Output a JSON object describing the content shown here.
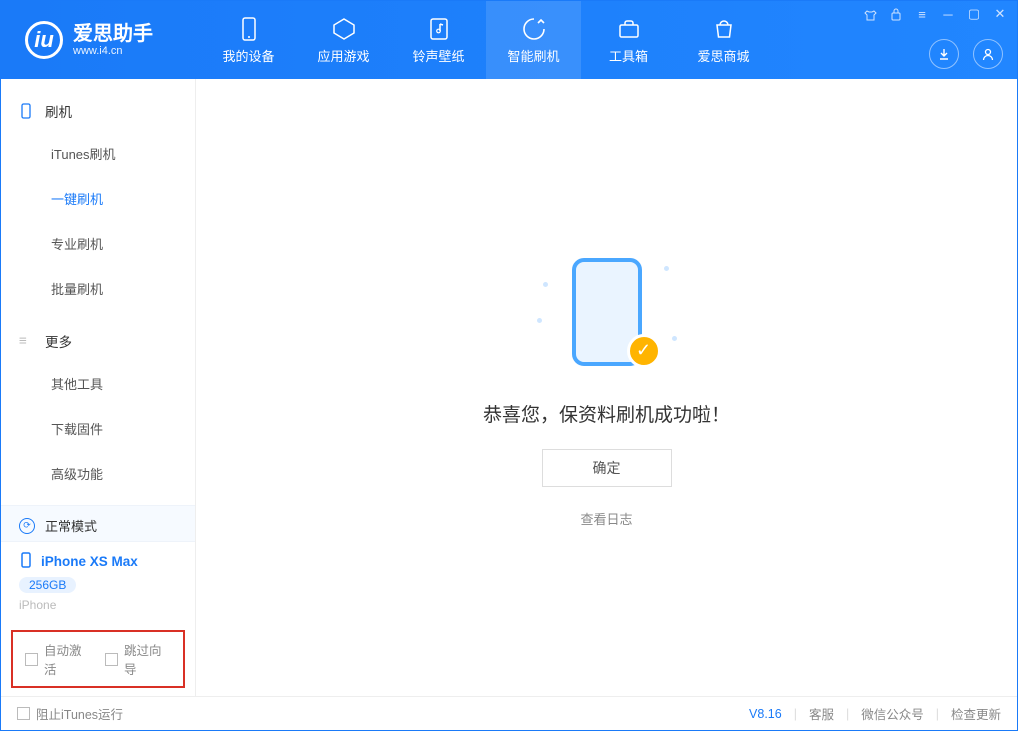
{
  "app": {
    "name": "爱思助手",
    "url": "www.i4.cn"
  },
  "tabs": [
    {
      "label": "我的设备",
      "icon": "device-icon"
    },
    {
      "label": "应用游戏",
      "icon": "apps-icon"
    },
    {
      "label": "铃声壁纸",
      "icon": "music-icon"
    },
    {
      "label": "智能刷机",
      "icon": "flash-icon",
      "active": true
    },
    {
      "label": "工具箱",
      "icon": "toolbox-icon"
    },
    {
      "label": "爱思商城",
      "icon": "store-icon"
    }
  ],
  "sidebar": {
    "section1": {
      "title": "刷机",
      "icon": "phone-icon"
    },
    "items1": [
      "iTunes刷机",
      "一键刷机",
      "专业刷机",
      "批量刷机"
    ],
    "active1_index": 1,
    "section2": {
      "title": "更多",
      "icon": "menu-icon"
    },
    "items2": [
      "其他工具",
      "下载固件",
      "高级功能"
    ],
    "mode": {
      "label": "正常模式"
    },
    "device": {
      "name": "iPhone XS Max",
      "storage": "256GB",
      "type": "iPhone"
    },
    "checks": {
      "auto_activate": "自动激活",
      "skip_guide": "跳过向导"
    }
  },
  "main": {
    "success_msg": "恭喜您，保资料刷机成功啦！",
    "ok_btn": "确定",
    "log_link": "查看日志"
  },
  "footer": {
    "block_itunes": "阻止iTunes运行",
    "version": "V8.16",
    "links": [
      "客服",
      "微信公众号",
      "检查更新"
    ]
  }
}
